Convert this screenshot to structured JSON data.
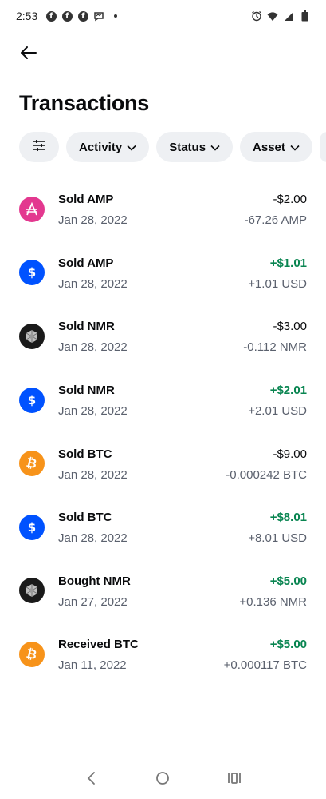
{
  "status_bar": {
    "time": "2:53",
    "notification_icons": [
      "facebook-icon",
      "facebook-icon",
      "facebook-icon",
      "messenger-icon"
    ],
    "system_icons": [
      "alarm-icon",
      "wifi-icon",
      "signal-icon",
      "battery-icon"
    ]
  },
  "header": {
    "title": "Transactions"
  },
  "filters": [
    {
      "label": "",
      "icon": "filter-sliders-icon"
    },
    {
      "label": "Activity",
      "icon": "chevron-down-icon"
    },
    {
      "label": "Status",
      "icon": "chevron-down-icon"
    },
    {
      "label": "Asset",
      "icon": "chevron-down-icon"
    }
  ],
  "transactions": [
    {
      "title": "Sold AMP",
      "date": "Jan 28, 2022",
      "fiat": "-$2.00",
      "crypto": "-67.26 AMP",
      "asset": "amp",
      "positive": false
    },
    {
      "title": "Sold AMP",
      "date": "Jan 28, 2022",
      "fiat": "+$1.01",
      "crypto": "+1.01 USD",
      "asset": "usd",
      "positive": true
    },
    {
      "title": "Sold NMR",
      "date": "Jan 28, 2022",
      "fiat": "-$3.00",
      "crypto": "-0.112 NMR",
      "asset": "nmr",
      "positive": false
    },
    {
      "title": "Sold NMR",
      "date": "Jan 28, 2022",
      "fiat": "+$2.01",
      "crypto": "+2.01 USD",
      "asset": "usd",
      "positive": true
    },
    {
      "title": "Sold BTC",
      "date": "Jan 28, 2022",
      "fiat": "-$9.00",
      "crypto": "-0.000242 BTC",
      "asset": "btc",
      "positive": false
    },
    {
      "title": "Sold BTC",
      "date": "Jan 28, 2022",
      "fiat": "+$8.01",
      "crypto": "+8.01 USD",
      "asset": "usd",
      "positive": true
    },
    {
      "title": "Bought NMR",
      "date": "Jan 27, 2022",
      "fiat": "+$5.00",
      "crypto": "+0.136 NMR",
      "asset": "nmr",
      "positive": true
    },
    {
      "title": "Received BTC",
      "date": "Jan 11, 2022",
      "fiat": "+$5.00",
      "crypto": "+0.000117 BTC",
      "asset": "btc",
      "positive": true
    }
  ],
  "colors": {
    "positive": "#098551",
    "amp": "#e3388f",
    "usd": "#0052ff",
    "nmr": "#1a1a1a",
    "btc": "#f7931a",
    "chip_bg": "#eef0f3"
  },
  "nav_bar": {
    "buttons": [
      "back-nav-icon",
      "home-nav-icon",
      "recents-nav-icon"
    ]
  }
}
